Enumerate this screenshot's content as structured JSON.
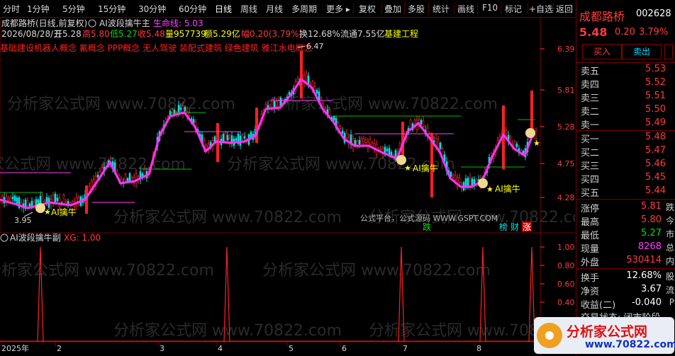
{
  "toolbar": {
    "items": [
      "分时",
      "1分钟",
      "5分钟",
      "15分钟",
      "30分钟",
      "60分钟",
      "日线",
      "周线",
      "月线",
      "多周期",
      "更多 ▸"
    ],
    "right_items": [
      "复权",
      "叠加",
      "多股",
      "统计",
      "画线",
      "F10",
      "标记",
      "+自选",
      "返回"
    ]
  },
  "header": {
    "stock_title": "成都路桥(日线,前复权)",
    "main_indicator": "AI波段擒牛主",
    "lifeline_label": "生命线: 5.03",
    "date": "2026/08/28/五",
    "open_label": "开5.28",
    "high_label": "高5.80",
    "low_label": "低5.27",
    "close_label": "收5.48",
    "vol_label": "量957739",
    "amount_label": "额5.29亿",
    "change_label": "幅0.20(3.79%)",
    "turnover_label": "换12.68%",
    "float_label": "流通7.55亿",
    "sector_label": "基建工程",
    "concepts": "基础建设机器人概念 氟概念 PPP概念 无人驾驶 装配式建筑 绿色建筑 雅江水电概念"
  },
  "price_axis": [
    "6.39",
    "5.81",
    "5.28",
    "4.75",
    "4.28"
  ],
  "annotations": {
    "high_price": "6.47",
    "low_price": "3.95",
    "signal_label": "AI擒牛",
    "watermark_small": "公式平台，公式源码 WWW.GSPT.COM",
    "marker_die": "跌",
    "marker_bang": "榜",
    "marker_cai": "财",
    "marker_zhang": "涨"
  },
  "sub_panel": {
    "title": "AI波段擒牛副",
    "xg_label": "XG: 1.00",
    "axis": [
      "1.00",
      "0.80",
      "0.60",
      "0.40"
    ]
  },
  "time_axis": [
    "2025年",
    "2",
    "3",
    "4",
    "5",
    "6",
    "7",
    "8"
  ],
  "sidebar": {
    "name": "成都路桥",
    "code": "002628",
    "price": "5.48",
    "change": "0.20",
    "pct": "3.79%",
    "buy_btn": "买入",
    "sell_btn": "卖出",
    "asks": [
      {
        "label": "卖五",
        "price": "5.53"
      },
      {
        "label": "卖四",
        "price": "5.52"
      },
      {
        "label": "卖三",
        "price": "5.51"
      },
      {
        "label": "卖二",
        "price": "5.50"
      },
      {
        "label": "卖一",
        "price": "5.49"
      }
    ],
    "bids": [
      {
        "label": "买一",
        "price": "5.48"
      },
      {
        "label": "买二",
        "price": "5.47"
      },
      {
        "label": "买三",
        "price": "5.46"
      },
      {
        "label": "买四",
        "price": "5.45"
      },
      {
        "label": "买五",
        "price": "5.44"
      }
    ],
    "stats": [
      {
        "label": "涨停",
        "value": "5.81",
        "ext": "跌"
      },
      {
        "label": "最高",
        "value": "5.80",
        "ext": "今"
      },
      {
        "label": "最低",
        "value": "5.27",
        "ext": "市"
      },
      {
        "label": "现量",
        "value": "8268",
        "ext": "总"
      },
      {
        "label": "外盘",
        "value": "530414",
        "ext": "内"
      }
    ],
    "stats2": [
      {
        "label": "换手",
        "value": "12.68%",
        "ext": "股"
      },
      {
        "label": "净资",
        "value": "3.67",
        "ext": "流"
      },
      {
        "label": "收益(二)",
        "value": "-0.040",
        "ext": "P"
      }
    ],
    "status": "交易状态: 闭市阶段",
    "logo_text": "分析家公式网",
    "logo_url": "www.70822.com"
  },
  "watermark": "分析家公式网 www.70822.com"
}
